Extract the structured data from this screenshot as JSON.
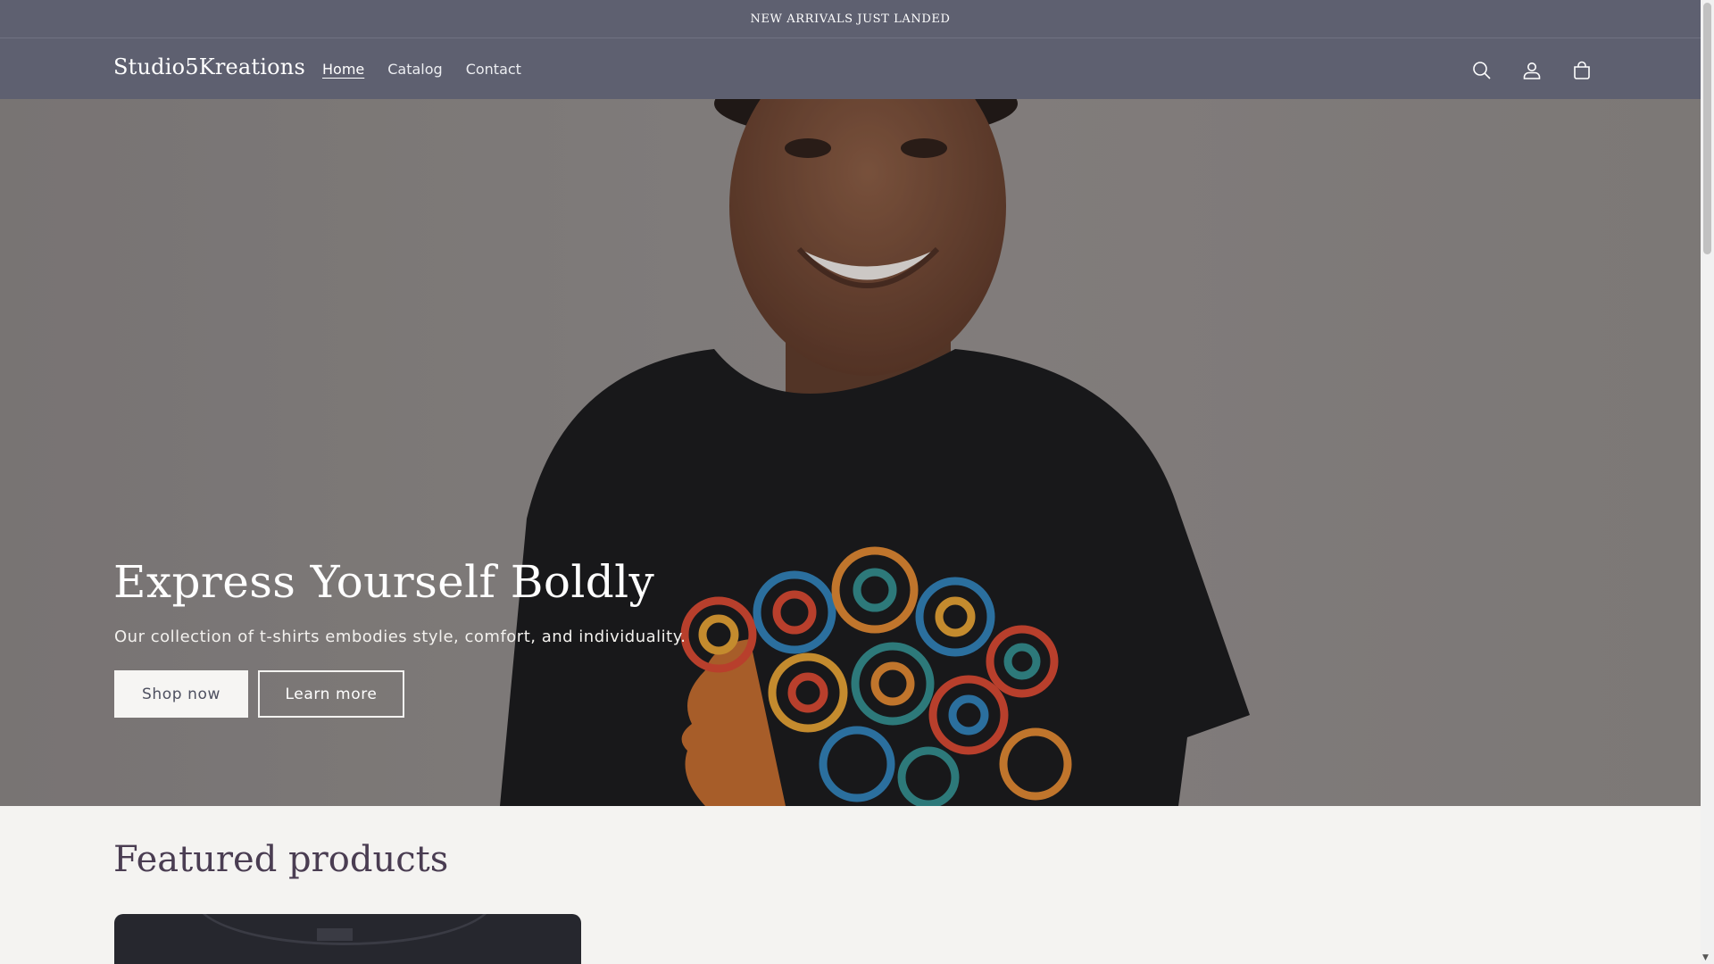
{
  "announcement": {
    "text": "NEW ARRIVALS JUST LANDED"
  },
  "header": {
    "logo": "Studio5Kreations",
    "nav": [
      {
        "label": "Home",
        "active": true
      },
      {
        "label": "Catalog",
        "active": false
      },
      {
        "label": "Contact",
        "active": false
      }
    ],
    "icons": [
      "search-icon",
      "account-icon",
      "cart-icon"
    ]
  },
  "hero": {
    "title": "Express Yourself Boldly",
    "subtitle": "Our collection of t-shirts embodies style, comfort, and individuality.",
    "primary_button": "Shop now",
    "secondary_button": "Learn more"
  },
  "featured": {
    "title": "Featured products"
  },
  "colors": {
    "header_bg": "#5e6070",
    "page_bg": "#f4f3f1",
    "heading": "#4a3d52"
  }
}
